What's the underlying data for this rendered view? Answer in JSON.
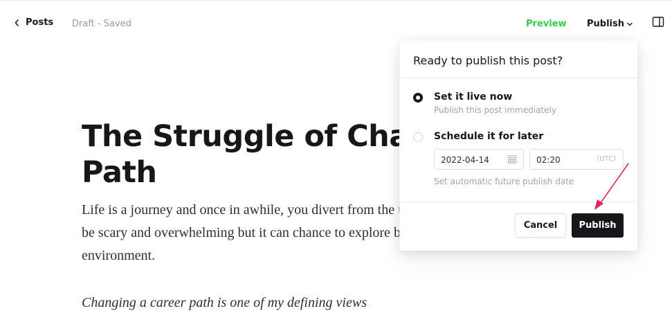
{
  "topbar": {
    "back_label": "Posts",
    "status": "Draft - Saved",
    "preview_label": "Preview",
    "publish_label": "Publish",
    "preview_color": "#30cf43"
  },
  "post": {
    "title": "The Struggle of Chan\nPath",
    "paragraph1": "Life is a journey and once in awhile, you divert from the unknown. This can be scary and overwhelming but it can chance to explore beyond the current environment.",
    "paragraph2": "Changing a career path is one of my defining views"
  },
  "publish_popover": {
    "title": "Ready to publish this post?",
    "option_now": {
      "title": "Set it live now",
      "description": "Publish this post immediately",
      "selected": true
    },
    "option_later": {
      "title": "Schedule it for later",
      "selected": false,
      "date_value": "2022-04-14",
      "time_value": "02:20",
      "timezone": "(UTC)",
      "hint": "Set automatic future publish date"
    },
    "cancel_label": "Cancel",
    "publish_label": "Publish"
  },
  "annotation": {
    "arrow_color": "#e5245a"
  },
  "icons": {
    "back": "chevron-left-icon",
    "publish_menu": "chevron-down-icon",
    "sidebar": "sidebar-toggle-icon",
    "date": "calendar-icon"
  }
}
